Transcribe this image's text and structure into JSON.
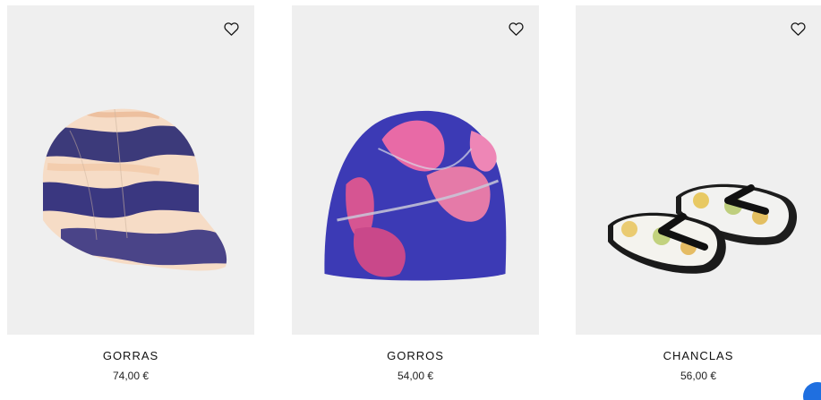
{
  "products": [
    {
      "title": "GORRAS",
      "price": "74,00 €",
      "image_alt": "tie-dye cap"
    },
    {
      "title": "GORROS",
      "price": "54,00 €",
      "image_alt": "floral beanie"
    },
    {
      "title": "CHANCLAS",
      "price": "56,00 €",
      "image_alt": "flip flops"
    }
  ],
  "icons": {
    "favorite": "heart-outline-icon",
    "chat": "chat-bubble-icon"
  },
  "colors": {
    "card_background": "#efefef",
    "chat_accent": "#1f6fe0"
  }
}
